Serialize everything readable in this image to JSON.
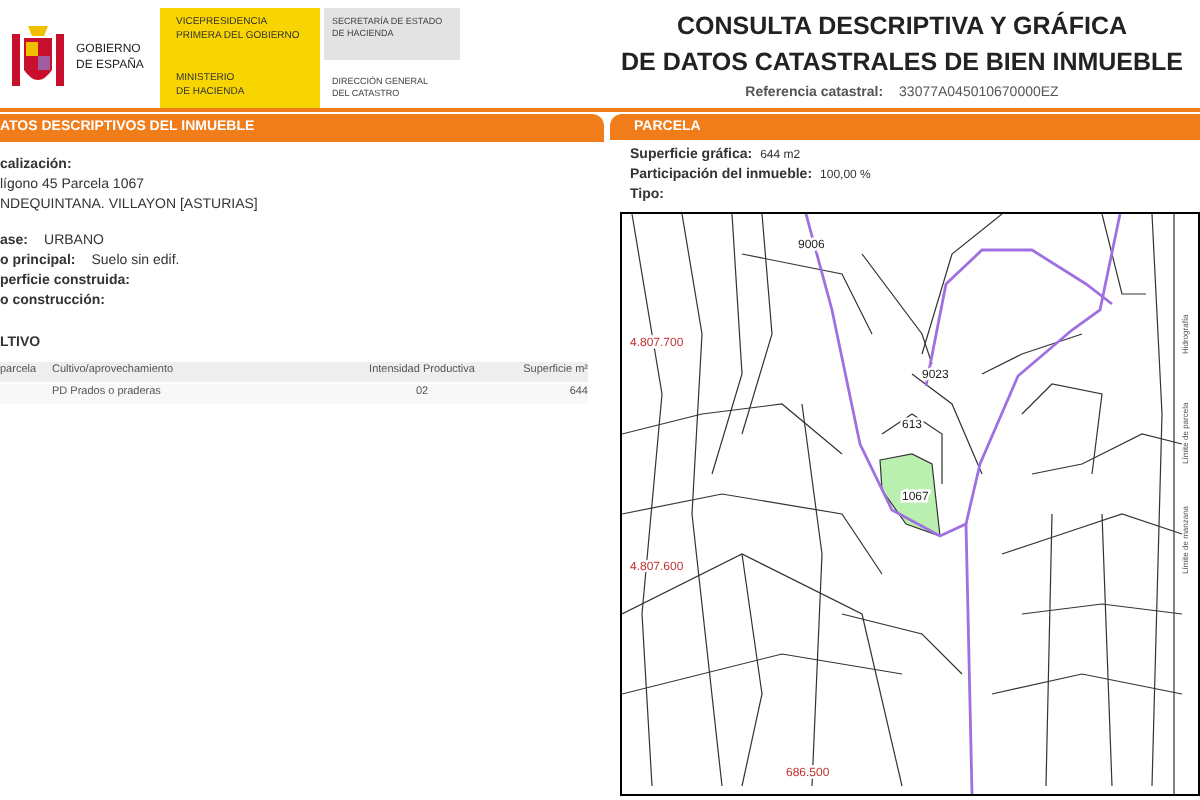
{
  "header": {
    "government": [
      "GOBIERNO",
      "DE ESPAÑA"
    ],
    "vicepresidency": [
      "VICEPRESIDENCIA",
      "PRIMERA DEL GOBIERNO"
    ],
    "ministry": [
      "MINISTERIO",
      "DE HACIENDA"
    ],
    "secretariat": [
      "SECRETARÍA DE ESTADO",
      "DE HACIENDA"
    ],
    "directorate": [
      "DIRECCIÓN GENERAL",
      "DEL CATASTRO"
    ]
  },
  "title": [
    "CONSULTA DESCRIPTIVA Y GRÁFICA",
    "DE DATOS CATASTRALES DE BIEN INMUEBLE"
  ],
  "reference": {
    "label": "Referencia catastral:",
    "value": "33077A045010670000EZ"
  },
  "descriptive": {
    "title": "ATOS DESCRIPTIVOS DEL INMUEBLE",
    "items": [
      {
        "kind": "heading",
        "label": "calización:"
      },
      {
        "kind": "line",
        "text": "lígono 45 Parcela 1067"
      },
      {
        "kind": "line",
        "text": "NDEQUINTANA. VILLAYON [ASTURIAS]"
      },
      {
        "kind": "pair",
        "label": "ase:",
        "value": "URBANO"
      },
      {
        "kind": "pair",
        "label": "o principal:",
        "value": "Suelo sin edif."
      },
      {
        "kind": "heading",
        "label": "perficie construida:"
      },
      {
        "kind": "heading",
        "label": "o construcción:"
      }
    ]
  },
  "cultivo": {
    "title": "LTIVO",
    "columns": [
      "parcela",
      "Cultivo/aprovechamiento",
      "Intensidad Productiva",
      "Superficie m²"
    ],
    "rows": [
      [
        "",
        "PD Prados o praderas",
        "02",
        "644"
      ]
    ]
  },
  "parcela": {
    "title": "PARCELA",
    "fields": [
      {
        "label": "Superficie gráfica:",
        "value": "644 m2"
      },
      {
        "label": "Participación del inmueble:",
        "value": "100,00 %"
      },
      {
        "label": "Tipo:"
      }
    ]
  },
  "map": {
    "labels": [
      "9006",
      "9023",
      "613",
      "1067",
      "4.807.700",
      "4.807.600",
      "686.500"
    ],
    "legend": [
      "Límite de manzana",
      "Límite de parcela",
      "Hidrografía"
    ]
  }
}
